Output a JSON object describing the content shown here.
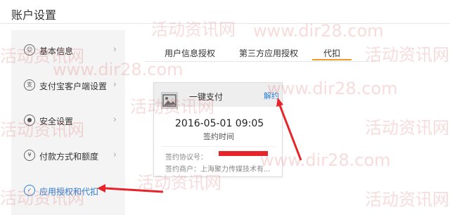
{
  "page": {
    "title": "账户设置"
  },
  "sidebar": {
    "items": [
      {
        "label": "基本信息",
        "icon": "person-icon",
        "active": false
      },
      {
        "label": "支付宝客户端设置",
        "icon": "alipay-icon",
        "active": false
      },
      {
        "label": "安全设置",
        "icon": "lock-icon",
        "active": false
      },
      {
        "label": "付款方式和额度",
        "icon": "yen-icon",
        "active": false
      },
      {
        "label": "应用授权和代扣",
        "icon": "check-circle-icon",
        "active": true
      }
    ]
  },
  "tabs": [
    {
      "label": "用户信息授权",
      "active": false
    },
    {
      "label": "第三方应用授权",
      "active": false
    },
    {
      "label": "代扣",
      "active": true
    }
  ],
  "card": {
    "title": "一键支付",
    "action": "解约",
    "date": "2016-05-01 09:05",
    "date_label": "签约时间",
    "agreement_label": "签约协议号：",
    "merchant": "签约商户：上海聚力传媒技术有..."
  },
  "watermark": {
    "cn": "活动资讯网",
    "url": "www.dir28.com"
  },
  "colors": {
    "accent": "#2d7fd6",
    "tab_underline": "#f39a2d",
    "annotation_arrow": "#e8242b"
  }
}
